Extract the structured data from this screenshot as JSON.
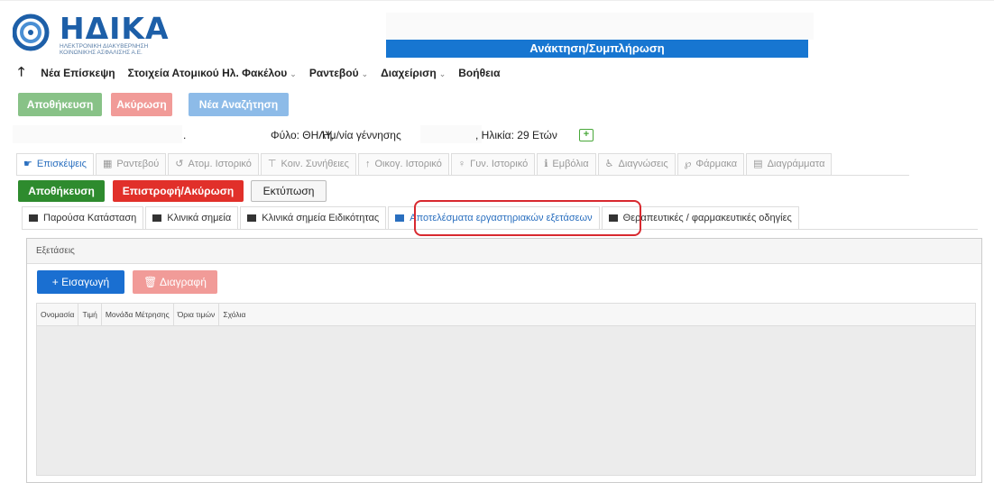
{
  "header": {
    "logo_text": "ΗΔΙΚΑ",
    "logo_sub": "ΗΛΕΚΤΡΟΝΙΚΗ ΔΙΑΚΥΒΕΡΝΗΣΗ ΚΟΙΝΩΝΙΚΗΣ ΑΣΦΑΛΙΣΗΣ Α.Ε.",
    "banner": "Ανάκτηση/Συμπλήρωση"
  },
  "menu": {
    "items": [
      {
        "label": "Νέα Επίσκεψη",
        "caret": false
      },
      {
        "label": "Στοιχεία Ατομικού Ηλ. Φακέλου",
        "caret": true
      },
      {
        "label": "Ραντεβού",
        "caret": true
      },
      {
        "label": "Διαχείριση",
        "caret": true
      },
      {
        "label": "Βοήθεια",
        "caret": false
      }
    ]
  },
  "top_buttons": {
    "save": "Αποθήκευση",
    "cancel": "Ακύρωση",
    "new_search": "Νέα Αναζήτηση"
  },
  "patient": {
    "dot": ".",
    "gender": "Φύλο: ΘΗΛΥ,",
    "birth_label": "Ημ/νία γέννησης",
    "age": ", Ηλικία: 29 Ετών"
  },
  "main_tabs": [
    {
      "label": "Επισκέψεις",
      "icon": "hand-pointer-icon",
      "glyph": "☛",
      "active": true
    },
    {
      "label": "Ραντεβού",
      "icon": "calendar-icon",
      "glyph": "▦",
      "active": false
    },
    {
      "label": "Ατομ. Ιστορικό",
      "icon": "history-icon",
      "glyph": "↺",
      "active": false
    },
    {
      "label": "Κοιν. Συνήθειες",
      "icon": "filter-icon",
      "glyph": "⊤",
      "active": false
    },
    {
      "label": "Οικογ. Ιστορικό",
      "icon": "family-icon",
      "glyph": "↑",
      "active": false
    },
    {
      "label": "Γυν. Ιστορικό",
      "icon": "gender-icon",
      "glyph": "♀",
      "active": false
    },
    {
      "label": "Εμβόλια",
      "icon": "info-icon",
      "glyph": "ℹ",
      "active": false
    },
    {
      "label": "Διαγνώσεις",
      "icon": "wheelchair-icon",
      "glyph": "♿",
      "active": false
    },
    {
      "label": "Φάρμακα",
      "icon": "pill-icon",
      "glyph": "℘",
      "active": false
    },
    {
      "label": "Διαγράμματα",
      "icon": "chart-icon",
      "glyph": "▤",
      "active": false
    }
  ],
  "visit_buttons": {
    "save": "Αποθήκευση",
    "return_cancel": "Επιστροφή/Ακύρωση",
    "print": "Εκτύπωση"
  },
  "sub_tabs": [
    {
      "label": "Παρούσα Κατάσταση",
      "active": false
    },
    {
      "label": "Κλινικά σημεία",
      "active": false
    },
    {
      "label": "Κλινικά σημεία Ειδικότητας",
      "active": false
    },
    {
      "label": "Αποτελέσματα εργαστηριακών εξετάσεων",
      "active": true
    },
    {
      "label": "Θεραπευτικές / φαρμακευτικές οδηγίες",
      "active": false
    }
  ],
  "panel": {
    "title": "Εξετάσεις",
    "insert": "+ Εισαγωγή",
    "delete": "🗑 Διαγραφή",
    "columns": [
      "Ονομασία",
      "Τιμή",
      "Μονάδα Μέτρησης",
      "Όρια τιμών",
      "Σχόλια"
    ]
  },
  "colors": {
    "accent_blue": "#1776d1",
    "save_green": "#2e8b2e",
    "danger_red": "#e1302a",
    "highlight_red": "#d8292f"
  }
}
